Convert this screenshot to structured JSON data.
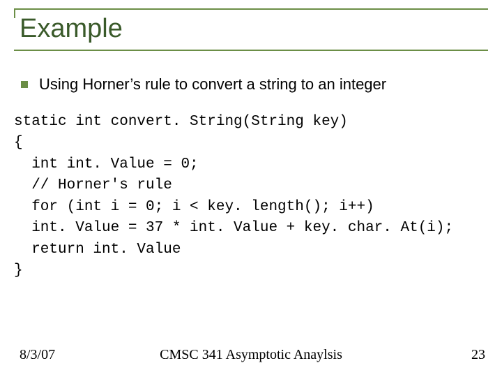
{
  "title": "Example",
  "bullet": "Using Horner’s rule to convert a string to an integer",
  "code": {
    "l1": "static int convert. String(String key)",
    "l2": "{",
    "l3": "  int int. Value = 0;",
    "l4": "  // Horner's rule",
    "l5": "  for (int i = 0; i < key. length(); i++)",
    "l6": "  int. Value = 37 * int. Value + key. char. At(i);",
    "l7": "  return int. Value",
    "l8": "}"
  },
  "footer": {
    "date": "8/3/07",
    "center": "CMSC 341 Asymptotic Anaylsis",
    "page": "23"
  }
}
